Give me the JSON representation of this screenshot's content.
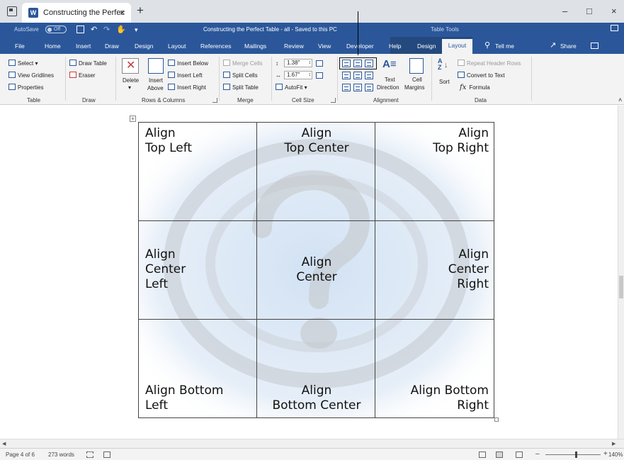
{
  "tabbar": {
    "tab_title": "Constructing the Perfec",
    "tab_close": "×",
    "new_tab": "+",
    "word_icon": "W",
    "minimize": "–",
    "maximize": "□",
    "close": "×"
  },
  "titlebar": {
    "autosave_label": "AutoSave",
    "autosave_state": "Off",
    "save_icon": "save-icon",
    "undo": "↶",
    "redo": "↷",
    "touch": "✋",
    "customize": "▾",
    "doc_title": "Constructing the Perfect Table - all  -  Saved to this PC",
    "table_tools": "Table Tools"
  },
  "ribbon_tabs": [
    "File",
    "Home",
    "Insert",
    "Draw",
    "Design",
    "Layout",
    "References",
    "Mailings",
    "Review",
    "View",
    "Developer",
    "Help",
    "Design"
  ],
  "active_tab": "Layout",
  "tell_me": "Tell me",
  "share": "Share",
  "ribbon": {
    "table": {
      "select": "Select ▾",
      "view_gridlines": "View Gridlines",
      "properties": "Properties",
      "label": "Table"
    },
    "draw": {
      "draw_table": "Draw Table",
      "eraser": "Eraser",
      "label": "Draw"
    },
    "rows_columns": {
      "delete": "Delete",
      "delete_arrow": "▾",
      "insert_above_1": "Insert",
      "insert_above_2": "Above",
      "insert_below": "Insert Below",
      "insert_left": "Insert Left",
      "insert_right": "Insert Right",
      "label": "Rows & Columns"
    },
    "merge": {
      "merge_cells": "Merge Cells",
      "split_cells": "Split Cells",
      "split_table": "Split Table",
      "label": "Merge"
    },
    "cell_size": {
      "height": "1.38\"",
      "width": "1.67\"",
      "autofit": "AutoFit ▾",
      "label": "Cell Size"
    },
    "alignment": {
      "text_direction_1": "Text",
      "text_direction_2": "Direction",
      "cell_margins_1": "Cell",
      "cell_margins_2": "Margins",
      "label": "Alignment"
    },
    "data": {
      "sort": "Sort",
      "repeat_header_rows": "Repeat Header Rows",
      "convert_to_text": "Convert to Text",
      "formula": "Formula",
      "fx": "fx",
      "label": "Data"
    }
  },
  "table": {
    "rows": [
      [
        "Align\nTop Left",
        "Align\nTop Center",
        "Align\nTop Right"
      ],
      [
        "Align\nCenter\nLeft",
        "Align\nCenter",
        "Align\nCenter\nRight"
      ],
      [
        "Align Bottom\nLeft",
        "Align\nBottom Center",
        "Align Bottom\nRight"
      ]
    ],
    "move_handle": "+"
  },
  "statusbar": {
    "page": "Page 4 of 6",
    "words": "273 words",
    "zoom_minus": "–",
    "zoom_plus": "+",
    "zoom": "140%"
  },
  "colors": {
    "word_blue": "#2b579a",
    "context_band": "#24497f",
    "ribbon_bg": "#f3f3f3",
    "watermark_blue": "#cfe0f3"
  }
}
